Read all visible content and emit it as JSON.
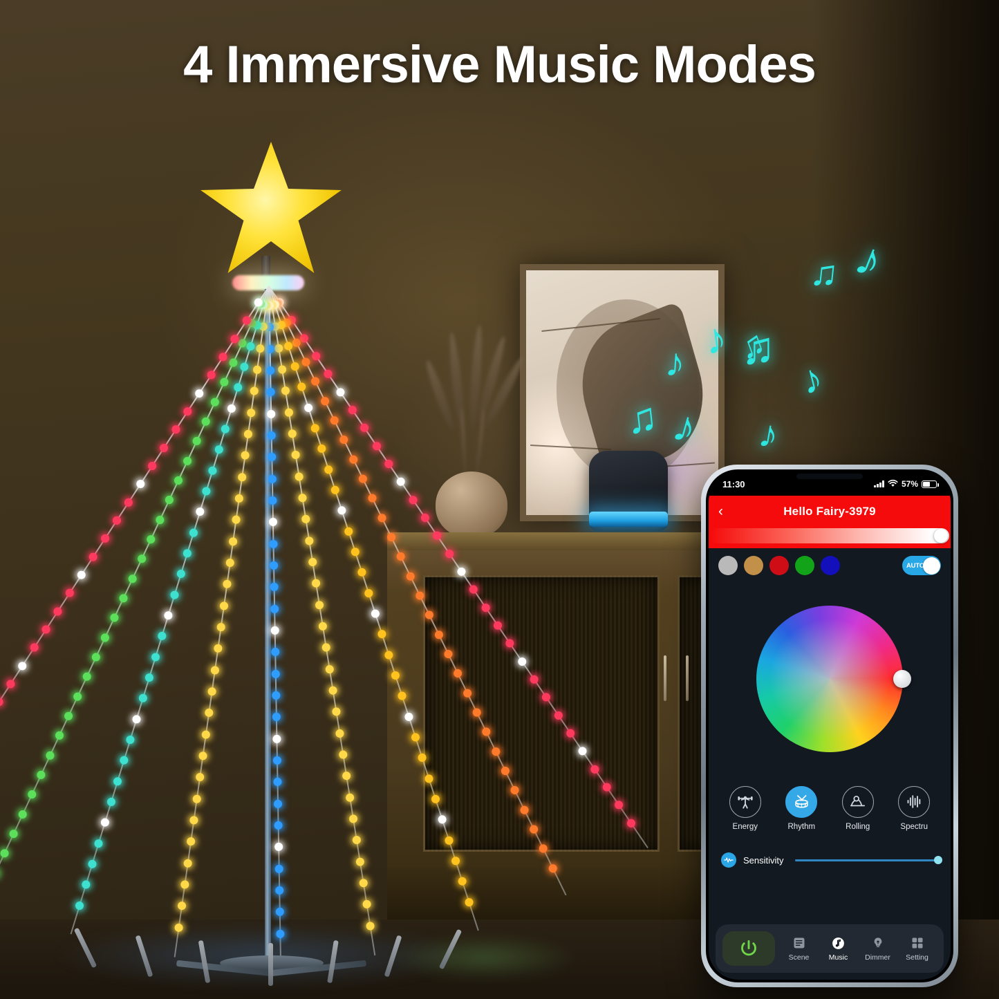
{
  "headline": "4 Immersive Music Modes",
  "scene": {
    "wall_color": "#45381f",
    "floor_color": "#241c11",
    "star_color": "#ffe23a",
    "note_color": "#2fe6e0",
    "speaker_ring_color": "#1f9fe0",
    "music_notes": [
      "♪",
      "♫",
      "♪",
      "♫",
      "♪",
      "♪",
      "♫",
      "♪",
      "♪",
      "♫"
    ],
    "led_strand_colors": [
      "#ff3a5e",
      "#ff7a2a",
      "#ffc21e",
      "#ffd94a",
      "#2f9dff",
      "#ffd94a",
      "#3ee0d0",
      "#5ce05c"
    ]
  },
  "phone": {
    "status_bar": {
      "time": "11:30",
      "battery_percent": "57%",
      "wifi_icon": "wifi-icon",
      "signal_icon": "signal-bars-icon",
      "battery_icon": "battery-icon"
    },
    "app_bar": {
      "back_icon": "chevron-left-icon",
      "title": "Hello Fairy-3979",
      "bg_color": "#f50b0b"
    },
    "brightness_bar": {
      "from_color": "#f50b0b",
      "to_color": "#ffffff",
      "value": 100
    },
    "swatches": [
      {
        "name": "swatch-silver",
        "color": "#b9b9b9"
      },
      {
        "name": "swatch-gold",
        "color": "#c3904a"
      },
      {
        "name": "swatch-red",
        "color": "#cf0d16"
      },
      {
        "name": "swatch-green",
        "color": "#13a318"
      },
      {
        "name": "swatch-blue",
        "color": "#120fbb"
      }
    ],
    "auto_toggle": {
      "label": "AUTO",
      "on": true,
      "color": "#29a8e8"
    },
    "color_wheel": {
      "name": "color-wheel",
      "handle_position": "right"
    },
    "music_modes": [
      {
        "label": "Energy",
        "icon": "weightlifter-icon",
        "active": false
      },
      {
        "label": "Rhythm",
        "icon": "drum-icon",
        "active": true
      },
      {
        "label": "Rolling",
        "icon": "rolling-ball-icon",
        "active": false
      },
      {
        "label": "Spectru",
        "icon": "spectrum-bars-icon",
        "active": false
      }
    ],
    "sensitivity": {
      "label": "Sensitivity",
      "icon": "waveform-icon",
      "value": 100,
      "accent": "#2aa6e6"
    },
    "tab_bar": {
      "power_button": {
        "name": "power-button",
        "icon": "power-icon",
        "color": "#6fd64a"
      },
      "tabs": [
        {
          "label": "Scene",
          "icon": "list-icon",
          "active": false
        },
        {
          "label": "Music",
          "icon": "music-note-icon",
          "active": true
        },
        {
          "label": "Dimmer",
          "icon": "bulb-icon",
          "active": false
        },
        {
          "label": "Setting",
          "icon": "grid-icon",
          "active": false
        }
      ]
    }
  }
}
